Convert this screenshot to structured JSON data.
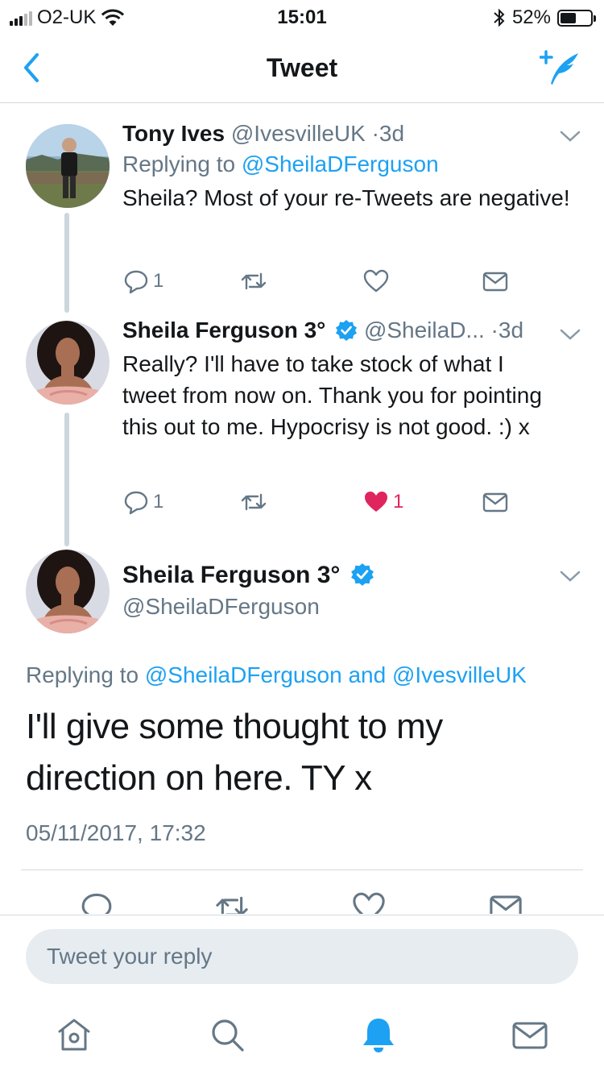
{
  "status_bar": {
    "carrier": "O2-UK",
    "time": "15:01",
    "battery": "52%",
    "battery_level": 0.52
  },
  "nav": {
    "title": "Tweet"
  },
  "tweets": [
    {
      "name": "Tony Ives",
      "handle": "@IvesvilleUK",
      "sep": "·",
      "time": "3d",
      "replying_label": "Replying to",
      "replying_to": "@SheilaDFerguson",
      "text": "Sheila? Most of your re-Tweets are negative!",
      "reply_count": "1",
      "like_count": ""
    },
    {
      "name": "Sheila Ferguson 3°",
      "handle": "@SheilaD...",
      "sep": "·",
      "time": "3d",
      "text": "Really? I'll have to take stock of what I tweet from now on. Thank you for pointing this out to me. Hypocrisy is not good. :)  x",
      "reply_count": "1",
      "like_count": "1"
    }
  ],
  "main_tweet": {
    "name": "Sheila Ferguson 3°",
    "handle": "@SheilaDFerguson",
    "replying_label": "Replying to",
    "replying_to_1": "@SheilaDFerguson",
    "and": "and",
    "replying_to_2": "@IvesvilleUK",
    "text": "I'll give some thought to my direction on here. TY x",
    "date": "05/11/2017, 17:32"
  },
  "reply_bar": {
    "placeholder": "Tweet your reply"
  },
  "colors": {
    "accent": "#1da1f2",
    "like": "#e0245e",
    "secondary_text": "#657786"
  }
}
